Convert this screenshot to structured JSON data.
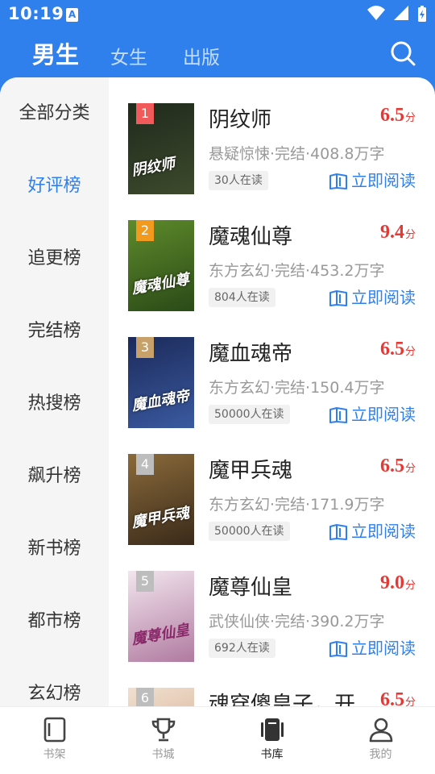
{
  "status_bar": {
    "time": "10:19",
    "app_icon": "A"
  },
  "top_tabs": [
    {
      "label": "男生",
      "active": true
    },
    {
      "label": "女生",
      "active": false
    },
    {
      "label": "出版",
      "active": false
    }
  ],
  "search": {
    "icon": "search-icon"
  },
  "sidebar": {
    "items": [
      {
        "label": "全部分类",
        "active": false
      },
      {
        "label": "好评榜",
        "active": true
      },
      {
        "label": "追更榜",
        "active": false
      },
      {
        "label": "完结榜",
        "active": false
      },
      {
        "label": "热搜榜",
        "active": false
      },
      {
        "label": "飙升榜",
        "active": false
      },
      {
        "label": "新书榜",
        "active": false
      },
      {
        "label": "都市榜",
        "active": false
      },
      {
        "label": "玄幻榜",
        "active": false
      }
    ]
  },
  "books": [
    {
      "rank": "1",
      "title": "阴纹师",
      "score": "6.5",
      "score_unit": "分",
      "meta": "悬疑惊悚·完结·408.8万字",
      "readers": "30人在读",
      "action": "立即阅读",
      "cover_text": "阴纹师",
      "cover_colors": [
        "#1f2a1c",
        "#3d4a2c"
      ],
      "badge_color": "#f05a5a"
    },
    {
      "rank": "2",
      "title": "魔魂仙尊",
      "score": "9.4",
      "score_unit": "分",
      "meta": "东方玄幻·完结·453.2万字",
      "readers": "804人在读",
      "action": "立即阅读",
      "cover_text": "魔魂仙尊",
      "cover_colors": [
        "#5e8a2a",
        "#2a4a18"
      ],
      "badge_color": "#f29a1e"
    },
    {
      "rank": "3",
      "title": "魔血魂帝",
      "score": "6.5",
      "score_unit": "分",
      "meta": "东方玄幻·完结·150.4万字",
      "readers": "50000人在读",
      "action": "立即阅读",
      "cover_text": "魔血魂帝",
      "cover_colors": [
        "#1c2a5a",
        "#3a5aa0"
      ],
      "badge_color": "#c8a06a"
    },
    {
      "rank": "4",
      "title": "魔甲兵魂",
      "score": "6.5",
      "score_unit": "分",
      "meta": "东方玄幻·完结·171.9万字",
      "readers": "50000人在读",
      "action": "立即阅读",
      "cover_text": "魔甲兵魂",
      "cover_colors": [
        "#8a6a3a",
        "#3a2a1a"
      ],
      "badge_color": "#bdbdbd"
    },
    {
      "rank": "5",
      "title": "魔尊仙皇",
      "score": "9.0",
      "score_unit": "分",
      "meta": "武侠仙侠·完结·390.2万字",
      "readers": "692人在读",
      "action": "立即阅读",
      "cover_text": "魔尊仙皇",
      "cover_colors": [
        "#f2e6ee",
        "#b07aa0"
      ],
      "badge_color": "#bdbdbd"
    },
    {
      "rank": "6",
      "title": "魂穿傻皇子，开",
      "score": "6.5",
      "score_unit": "分",
      "meta": "",
      "readers": "",
      "action": "",
      "cover_text": "",
      "cover_colors": [
        "#f0e0d0",
        "#d0a080"
      ],
      "badge_color": "#bdbdbd"
    }
  ],
  "bottom_nav": [
    {
      "label": "书架",
      "icon": "bookshelf-icon",
      "active": false
    },
    {
      "label": "书城",
      "icon": "trophy-icon",
      "active": false
    },
    {
      "label": "书库",
      "icon": "library-icon",
      "active": true
    },
    {
      "label": "我的",
      "icon": "profile-icon",
      "active": false
    }
  ],
  "colors": {
    "primary": "#2f80ed",
    "score": "#e53935",
    "sidebar_bg": "#f5f5f5"
  }
}
